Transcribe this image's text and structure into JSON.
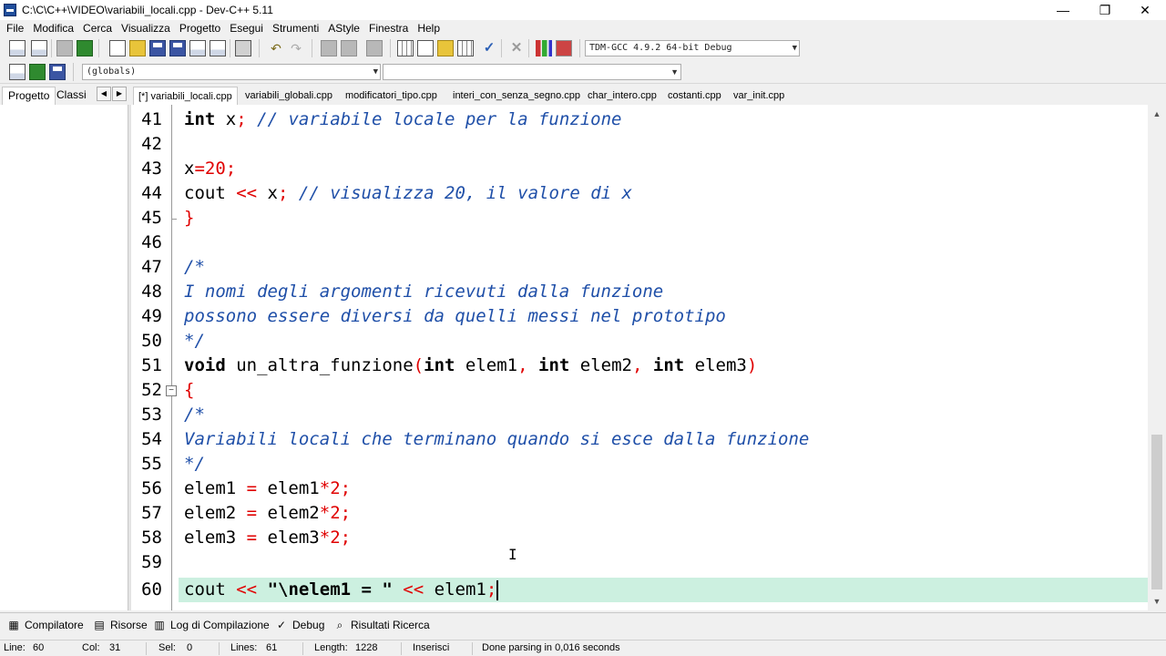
{
  "window": {
    "title": "C:\\C\\C++\\VIDEO\\variabili_locali.cpp - Dev-C++ 5.11",
    "minimize": "—",
    "maximize": "❐",
    "close": "✕"
  },
  "menu": [
    "File",
    "Modifica",
    "Cerca",
    "Visualizza",
    "Progetto",
    "Esegui",
    "Strumenti",
    "AStyle",
    "Finestra",
    "Help"
  ],
  "toolbar": {
    "compiler_select": "TDM-GCC 4.9.2 64-bit Debug",
    "scope_select": "(globals)",
    "function_select": ""
  },
  "left_tabs": [
    "Progetto",
    "Classi"
  ],
  "file_tabs": [
    "[*] variabili_locali.cpp",
    "variabili_globali.cpp",
    "modificatori_tipo.cpp",
    "interi_con_senza_segno.cpp",
    "char_intero.cpp",
    "costanti.cpp",
    "var_init.cpp"
  ],
  "editor": {
    "lines": [
      {
        "n": "41",
        "text": "int x; // variabile locale per la funzione"
      },
      {
        "n": "42",
        "text": ""
      },
      {
        "n": "43",
        "text": "x=20;"
      },
      {
        "n": "44",
        "text": "cout << x; // visualizza 20, il valore di x"
      },
      {
        "n": "45",
        "text": "}"
      },
      {
        "n": "46",
        "text": ""
      },
      {
        "n": "47",
        "text": "/*"
      },
      {
        "n": "48",
        "text": "I nomi degli argomenti ricevuti dalla funzione"
      },
      {
        "n": "49",
        "text": "possono essere diversi da quelli messi nel prototipo"
      },
      {
        "n": "50",
        "text": "*/"
      },
      {
        "n": "51",
        "text": "void un_altra_funzione(int elem1, int elem2, int elem3)"
      },
      {
        "n": "52",
        "text": "{"
      },
      {
        "n": "53",
        "text": "/*"
      },
      {
        "n": "54",
        "text": "Variabili locali che terminano quando si esce dalla funzione"
      },
      {
        "n": "55",
        "text": "*/"
      },
      {
        "n": "56",
        "text": "elem1 = elem1*2;"
      },
      {
        "n": "57",
        "text": "elem2 = elem2*2;"
      },
      {
        "n": "58",
        "text": "elem3 = elem3*2;"
      },
      {
        "n": "59",
        "text": ""
      },
      {
        "n": "60",
        "text": "cout << \"\\nelem1 = \" << elem1;"
      }
    ]
  },
  "bottom_tabs": [
    "Compilatore",
    "Risorse",
    "Log di Compilazione",
    "Debug",
    "Risultati Ricerca"
  ],
  "status": {
    "line_label": "Line:",
    "line": "60",
    "col_label": "Col:",
    "col": "31",
    "sel_label": "Sel:",
    "sel": "0",
    "lines_label": "Lines:",
    "lines": "61",
    "length_label": "Length:",
    "length": "1228",
    "mode": "Inserisci",
    "message": "Done parsing in 0,016 seconds"
  },
  "colors": {
    "keyword": "#000000",
    "symbol": "#e00000",
    "comment": "#1f4fa8",
    "current_line": "#ccf0e0"
  }
}
